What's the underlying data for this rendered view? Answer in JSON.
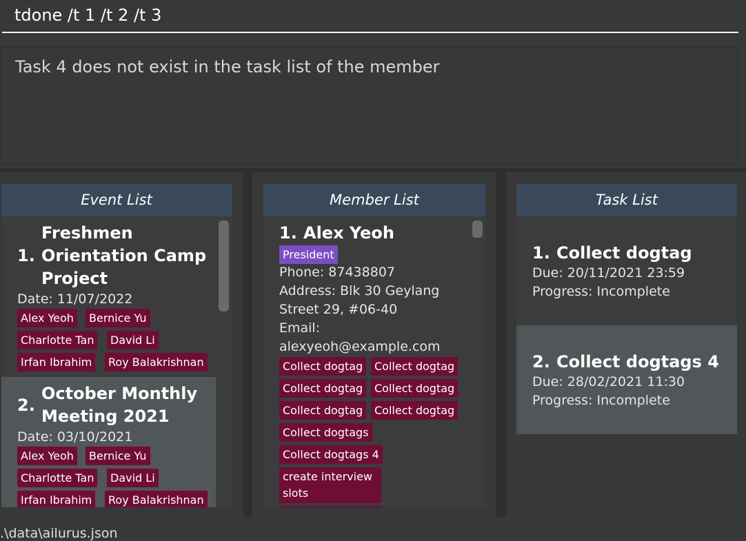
{
  "command": {
    "value": "tdone /t 1 /t 2 /t 3"
  },
  "result": {
    "message": "Task 4 does not exist in the task list of the member"
  },
  "event_panel": {
    "header": "Event List",
    "events": [
      {
        "index": "1.",
        "title_lines": [
          "Freshmen",
          "Orientation Camp",
          "Project"
        ],
        "date": "Date: 11/07/2022",
        "members": [
          "Alex Yeoh",
          "Bernice Yu",
          "Charlotte Tan",
          "David Li",
          "Irfan Ibrahim",
          "Roy Balakrishnan"
        ]
      },
      {
        "index": "2.",
        "title_lines": [
          "October Monthly",
          "Meeting 2021"
        ],
        "date": "Date: 03/10/2021",
        "members": [
          "Alex Yeoh",
          "Bernice Yu",
          "Charlotte Tan",
          "David Li",
          "Irfan Ibrahim",
          "Roy Balakrishnan"
        ]
      }
    ]
  },
  "member_panel": {
    "header": "Member List",
    "member": {
      "index": "1.",
      "name": "Alex Yeoh",
      "role": "President",
      "phone": "Phone: 87438807",
      "address_lines": [
        "Address: Blk 30 Geylang",
        "Street 29, #06-40"
      ],
      "email_lines": [
        "Email:",
        "alexyeoh@example.com"
      ],
      "tasks": [
        "Collect dogtag",
        "Collect dogtag",
        "Collect dogtag",
        "Collect dogtag",
        "Collect dogtag",
        "Collect dogtag",
        "Collect dogtags",
        "Collect dogtags 4",
        "create interview slots"
      ]
    }
  },
  "task_panel": {
    "header": "Task List",
    "tasks": [
      {
        "index": "1.",
        "name": "Collect dogtag",
        "due": "Due: 20/11/2021 23:59",
        "progress": "Progress: Incomplete"
      },
      {
        "index": "2.",
        "name": "Collect dogtags 4",
        "due": "Due: 28/02/2021 11:30",
        "progress": "Progress: Incomplete"
      }
    ]
  },
  "status_bar": {
    "path": ".\\data\\ailurus.json"
  },
  "colors": {
    "background": "#383838",
    "header": "#39495a",
    "tag": "#6f0d35",
    "role_tag": "#7b4fc2",
    "selected_card": "#515658"
  }
}
